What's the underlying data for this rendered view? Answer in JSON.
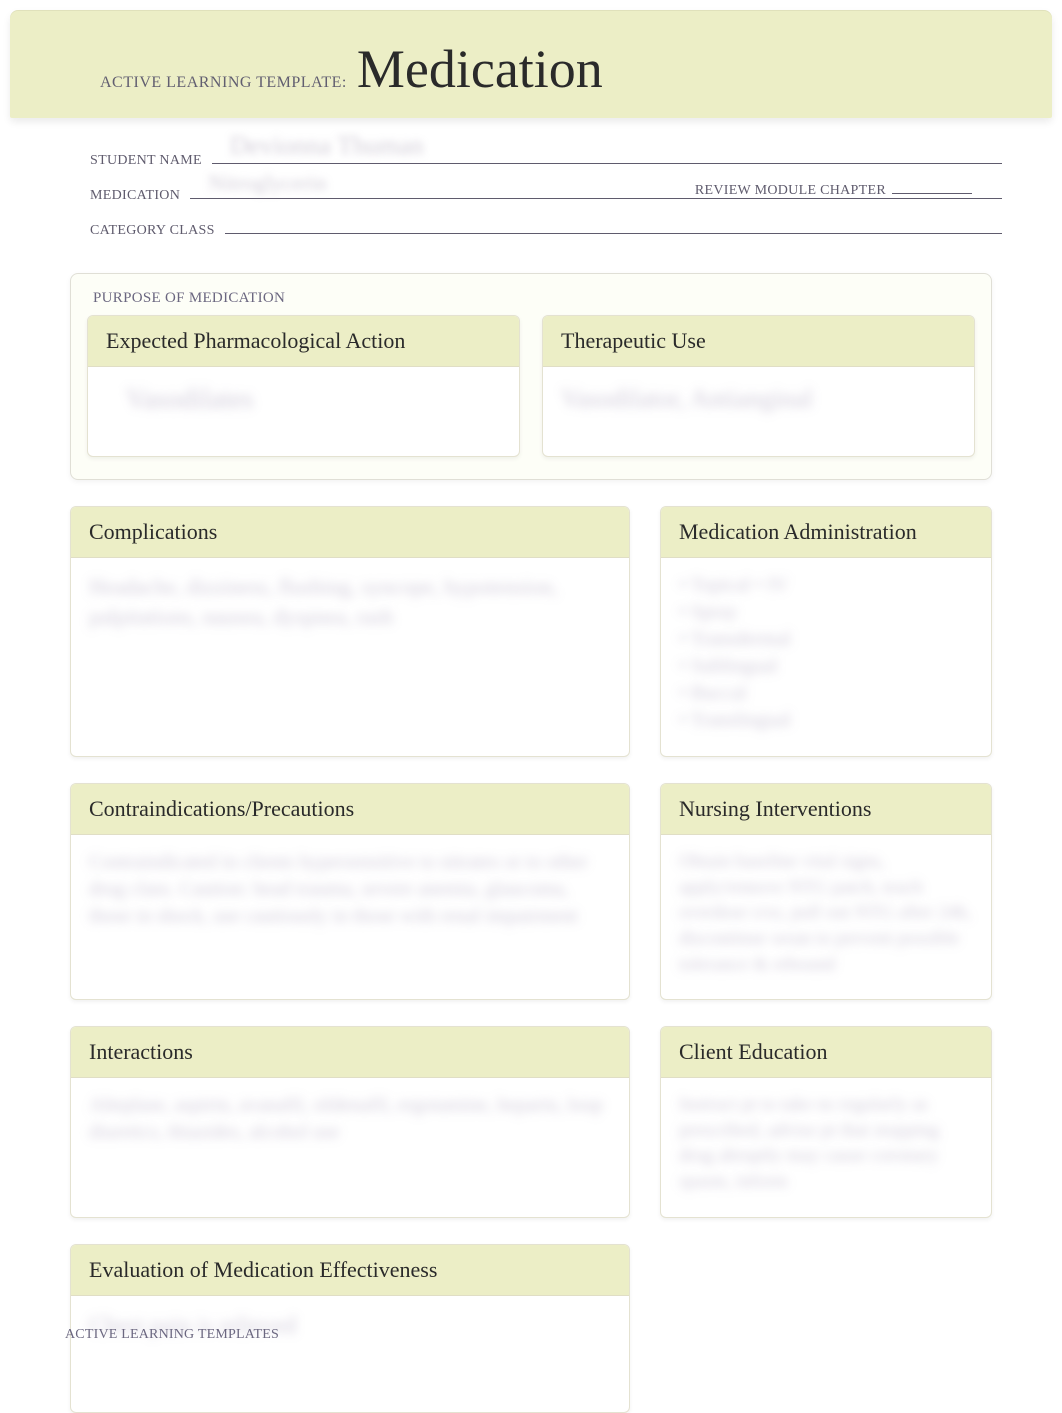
{
  "header": {
    "prefix": "ACTIVE LEARNING TEMPLATE:",
    "title": "Medication"
  },
  "info": {
    "student_label": "STUDENT NAME",
    "student_value_blur": "Devionna Thuman",
    "medication_label": "MEDICATION",
    "medication_value_blur": "Nitroglycerin",
    "review_label": "REVIEW MODULE CHAPTER",
    "review_value": "",
    "category_label": "CATEGORY CLASS",
    "category_value": ""
  },
  "sections": {
    "purpose_label": "PURPOSE OF MEDICATION",
    "expected_action": {
      "title": "Expected Pharmacological Action",
      "blur": "Vasodilates"
    },
    "therapeutic_use": {
      "title": "Therapeutic Use",
      "blur": "Vasodilator, Antianginal"
    },
    "complications": {
      "title": "Complications",
      "blur": "Headache, dizziness, flushing, syncope, hypotension, palpitations, nausea, dyspnea, rash"
    },
    "contraindications": {
      "title": "Contraindications/Precautions",
      "blur": "Contraindicated in clients hypersensitive to nitrates or to other drug class. Caution: head trauma, severe anemia, glaucoma, those in shock, use cautiously in those with renal impairment"
    },
    "interactions": {
      "title": "Interactions",
      "blur": "Alteplase, aspirin, avanafil, sildenafil, ergotamine, heparin, loop diuretics, thiazides, alcohol use"
    },
    "evaluation": {
      "title": "Evaluation of Medication Effectiveness",
      "blur": "Chest pain is relieved"
    },
    "med_admin": {
      "title": "Medication Administration",
      "blur": "• Topical  • IV\n• Spray\n• Transdermal\n• Sublingual\n• Buccal\n• Translingual"
    },
    "nursing": {
      "title": "Nursing Interventions",
      "blur": "Obtain baseline vital signs, apply/remove NTG patch, teach overdose s/sx, pull out NTG after 24h, discontinue wean to prevent possible tolerance & rebound"
    },
    "education": {
      "title": "Client Education",
      "blur": "Instruct pt to take ns regularly as prescribed, advise pt that stopping drug abruptly may cause coronary spasm, inform"
    }
  },
  "footer": "ACTIVE LEARNING TEMPLATES"
}
